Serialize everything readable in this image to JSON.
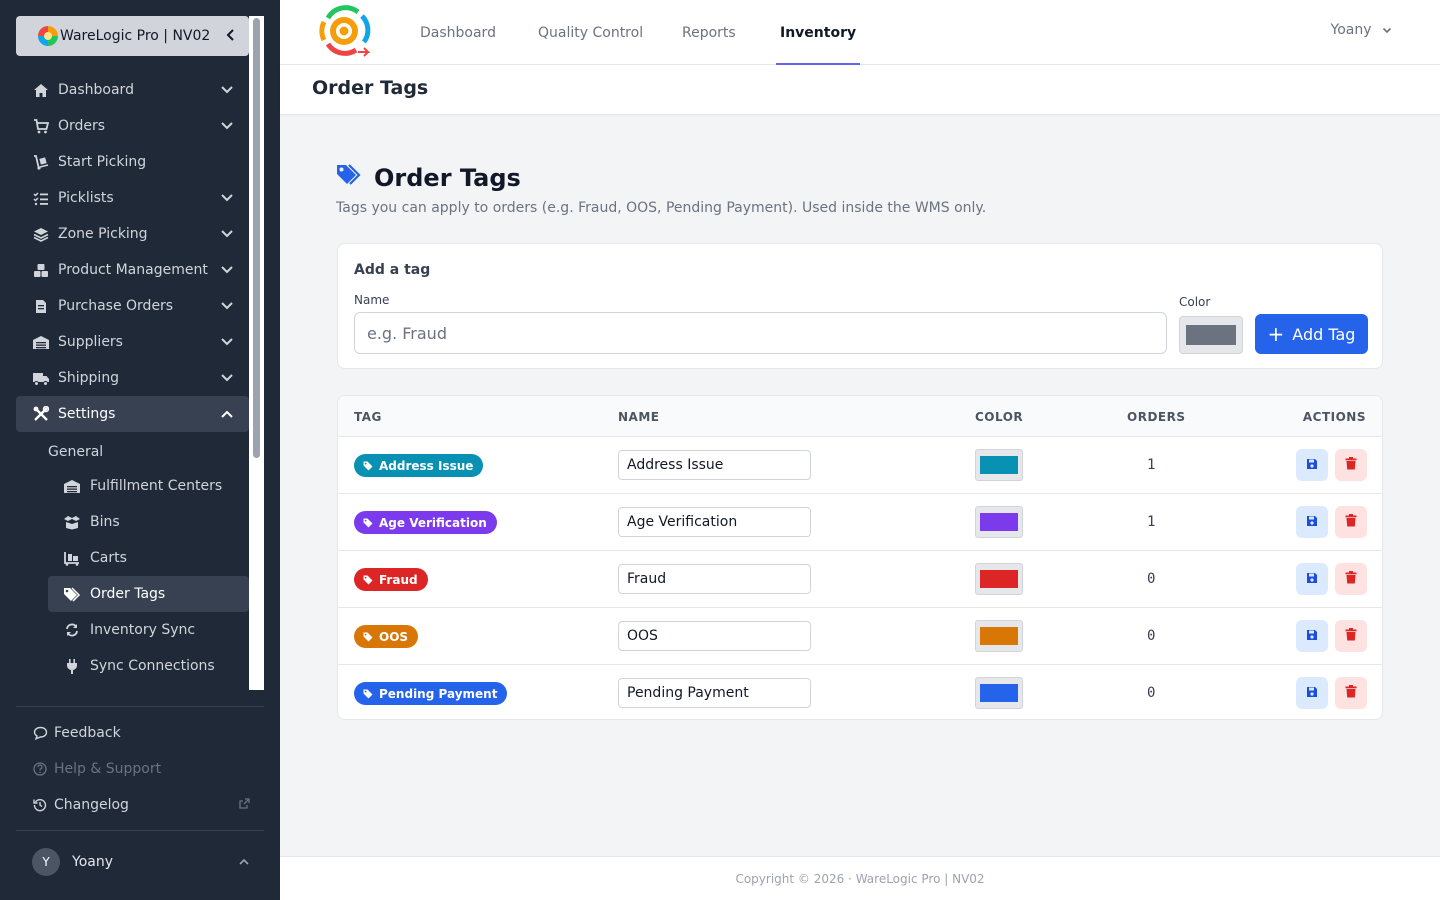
{
  "sidebar": {
    "brand": "WareLogic Pro | NV02",
    "collapse_icon": "chevron-left-icon",
    "items": [
      {
        "label": "Dashboard",
        "icon": "home-icon"
      },
      {
        "label": "Orders",
        "icon": "cart-icon"
      },
      {
        "label": "Start Picking",
        "icon": "hand-truck-icon"
      },
      {
        "label": "Picklists",
        "icon": "list-check-icon"
      },
      {
        "label": "Zone Picking",
        "icon": "layers-icon"
      },
      {
        "label": "Product Management",
        "icon": "boxes-icon"
      },
      {
        "label": "Purchase Orders",
        "icon": "file-invoice-icon"
      },
      {
        "label": "Suppliers",
        "icon": "warehouse-icon"
      },
      {
        "label": "Shipping",
        "icon": "truck-icon"
      },
      {
        "label": "Settings",
        "icon": "tools-icon"
      }
    ],
    "settings_group": "General",
    "settings_items": [
      {
        "label": "Fulfillment Centers",
        "icon": "warehouse-icon"
      },
      {
        "label": "Bins",
        "icon": "box-open-icon"
      },
      {
        "label": "Carts",
        "icon": "dolly-icon"
      },
      {
        "label": "Order Tags",
        "icon": "tags-icon"
      },
      {
        "label": "Inventory Sync",
        "icon": "sync-icon"
      },
      {
        "label": "Sync Connections",
        "icon": "plug-icon"
      }
    ],
    "bottom": {
      "feedback": "Feedback",
      "help": "Help & Support",
      "changelog": "Changelog"
    },
    "user": {
      "initial": "Y",
      "name": "Yoany"
    }
  },
  "topnav": {
    "tabs": [
      "Dashboard",
      "Quality Control",
      "Reports",
      "Inventory"
    ],
    "active": "Inventory",
    "user": "Yoany"
  },
  "page_header": "Order Tags",
  "main": {
    "title": "Order Tags",
    "subtitle": "Tags you can apply to orders (e.g. Fraud, OOS, Pending Payment). Used inside the WMS only."
  },
  "add_form": {
    "title": "Add a tag",
    "name_label": "Name",
    "name_placeholder": "e.g. Fraud",
    "color_label": "Color",
    "default_color": "#6b7280",
    "button": "Add Tag"
  },
  "table": {
    "headers": [
      "TAG",
      "NAME",
      "COLOR",
      "ORDERS",
      "ACTIONS"
    ],
    "rows": [
      {
        "tag": "Address Issue",
        "name": "Address Issue",
        "color": "#0891b2",
        "orders": "1"
      },
      {
        "tag": "Age Verification",
        "name": "Age Verification",
        "color": "#7c3aed",
        "orders": "1"
      },
      {
        "tag": "Fraud",
        "name": "Fraud",
        "color": "#dc2626",
        "orders": "0"
      },
      {
        "tag": "OOS",
        "name": "OOS",
        "color": "#d97706",
        "orders": "0"
      },
      {
        "tag": "Pending Payment",
        "name": "Pending Payment",
        "color": "#2563eb",
        "orders": "0"
      }
    ]
  },
  "footer": "Copyright © 2026 · WareLogic Pro | NV02"
}
